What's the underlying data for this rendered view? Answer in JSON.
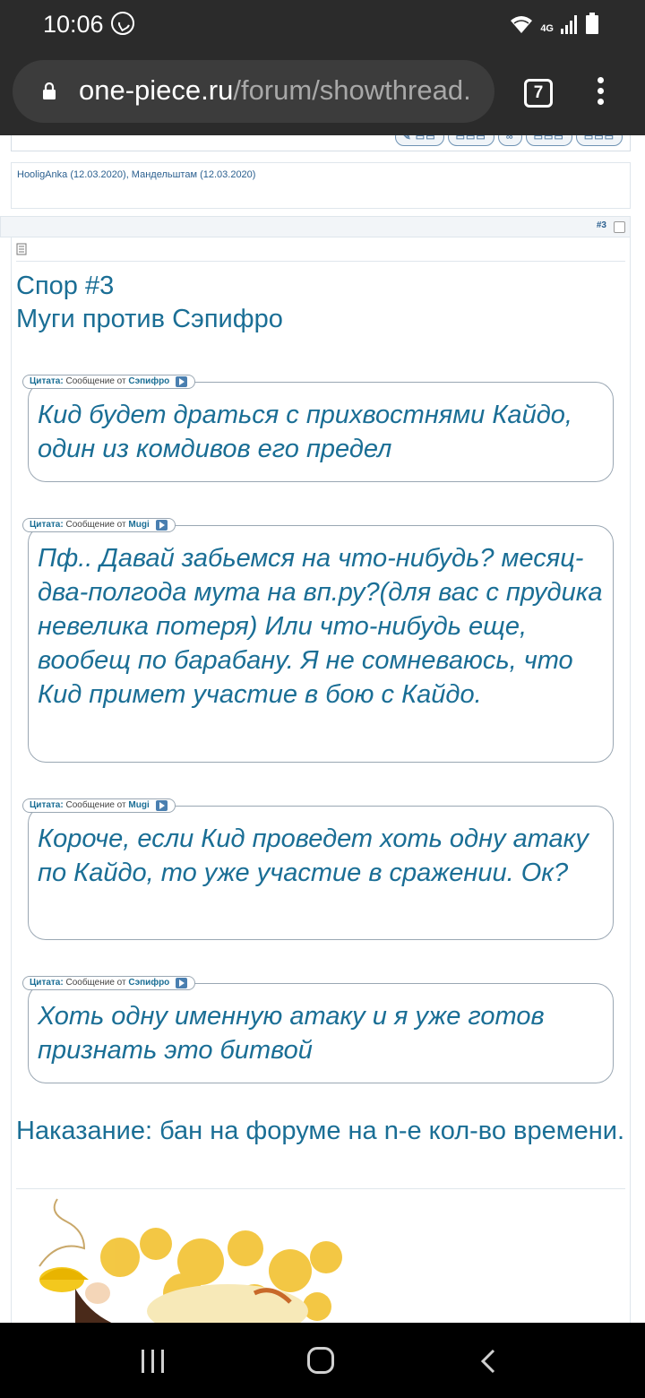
{
  "status_bar": {
    "time": "10:06",
    "network": "4G"
  },
  "browser": {
    "url_domain": "one-piece.ru",
    "url_path": "/forum/showthread.",
    "tab_count": "7"
  },
  "thanks": {
    "names": "HooligAnka (12.03.2020), Мандельштам (12.03.2020)"
  },
  "post": {
    "number": "#3",
    "title_line1": "Спор #3",
    "title_line2": "Муги против Сэпифро",
    "quote_label": "Цитата:",
    "quote_from": "Сообщение от",
    "quotes": [
      {
        "author": "Сэпифро",
        "text": "Кид будет драться с прихвостнями Кайдо, один из комдивов его предел"
      },
      {
        "author": "Mugi",
        "text": "Пф.. Давай забьемся на что-нибудь? месяц-два-полгода мута на вп.ру?(для вас с прудика невелика потеря) Или что-нибудь еще, вообещ по барабану. Я не сомневаюсь, что Кид примет участие в бою с Кайдо."
      },
      {
        "author": "Mugi",
        "text": "Короче, если Кид проведет хоть одну атаку по Кайдо, то уже участие в сражении. Ок?"
      },
      {
        "author": "Сэпифро",
        "text": "Хоть одну именную атаку и я уже готов признать это битвой"
      }
    ],
    "punishment": "Наказание: бан на форуме на n-е кол-во времени."
  },
  "colors": {
    "link": "#1a6e95",
    "chrome": "#2b2b2b"
  }
}
